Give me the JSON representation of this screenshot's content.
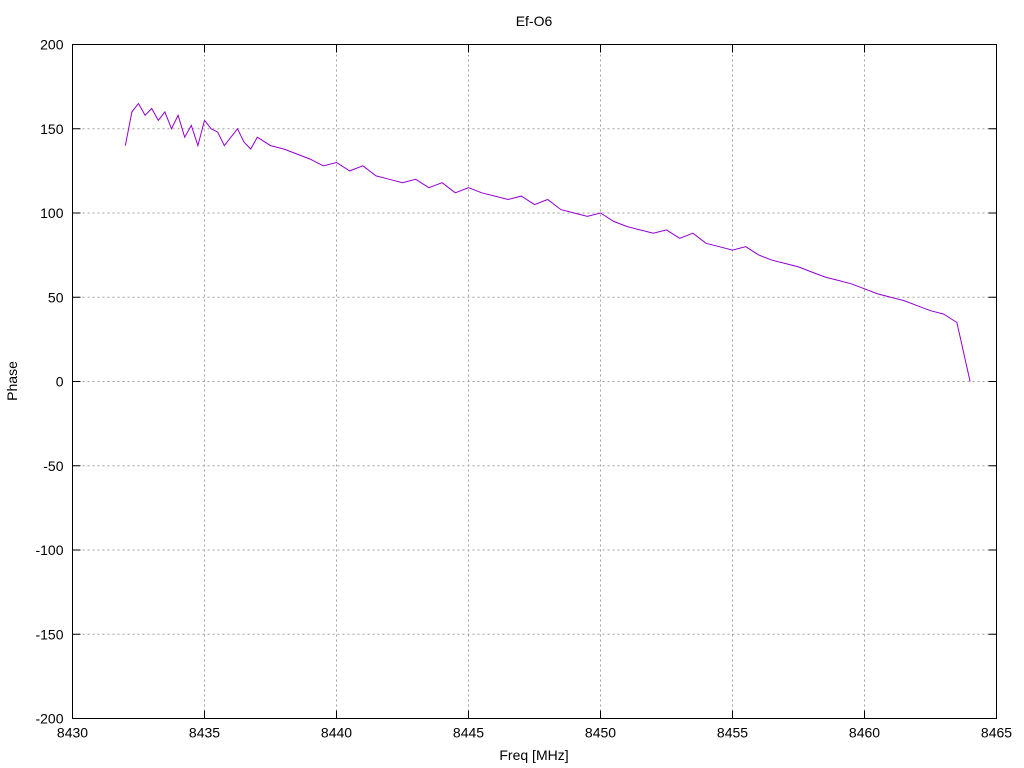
{
  "chart_data": {
    "type": "line",
    "title": "Ef-O6",
    "xlabel": "Freq [MHz]",
    "ylabel": "Phase",
    "xlim": [
      8430,
      8465
    ],
    "ylim": [
      -200,
      200
    ],
    "xticks": [
      8430,
      8435,
      8440,
      8445,
      8450,
      8455,
      8460,
      8465
    ],
    "yticks": [
      -200,
      -150,
      -100,
      -50,
      0,
      50,
      100,
      150,
      200
    ],
    "grid": true,
    "line_color": "#9400d3",
    "series": [
      {
        "x": [
          8432.0,
          8432.25,
          8432.5,
          8432.75,
          8433.0,
          8433.25,
          8433.5,
          8433.75,
          8434.0,
          8434.25,
          8434.5,
          8434.75,
          8435.0,
          8435.25,
          8435.5,
          8435.75,
          8436.0,
          8436.25,
          8436.5,
          8436.75,
          8437.0,
          8437.5,
          8438.0,
          8438.5,
          8439.0,
          8439.5,
          8440.0,
          8440.5,
          8441.0,
          8441.5,
          8442.0,
          8442.5,
          8443.0,
          8443.5,
          8444.0,
          8444.5,
          8445.0,
          8445.5,
          8446.0,
          8446.5,
          8447.0,
          8447.5,
          8448.0,
          8448.5,
          8449.0,
          8449.5,
          8450.0,
          8450.5,
          8451.0,
          8451.5,
          8452.0,
          8452.5,
          8453.0,
          8453.5,
          8454.0,
          8454.5,
          8455.0,
          8455.5,
          8456.0,
          8456.5,
          8457.0,
          8457.5,
          8458.0,
          8458.5,
          8459.0,
          8459.5,
          8460.0,
          8460.5,
          8461.0,
          8461.5,
          8462.0,
          8462.5,
          8463.0,
          8463.5,
          8464.0
        ],
        "y": [
          140,
          160,
          165,
          158,
          162,
          155,
          160,
          150,
          158,
          145,
          152,
          140,
          155,
          150,
          148,
          140,
          145,
          150,
          142,
          138,
          145,
          140,
          138,
          135,
          132,
          128,
          130,
          125,
          128,
          122,
          120,
          118,
          120,
          115,
          118,
          112,
          115,
          112,
          110,
          108,
          110,
          105,
          108,
          102,
          100,
          98,
          100,
          95,
          92,
          90,
          88,
          90,
          85,
          88,
          82,
          80,
          78,
          80,
          75,
          72,
          70,
          68,
          65,
          62,
          60,
          58,
          55,
          52,
          50,
          48,
          45,
          42,
          40,
          35,
          0
        ]
      }
    ]
  }
}
